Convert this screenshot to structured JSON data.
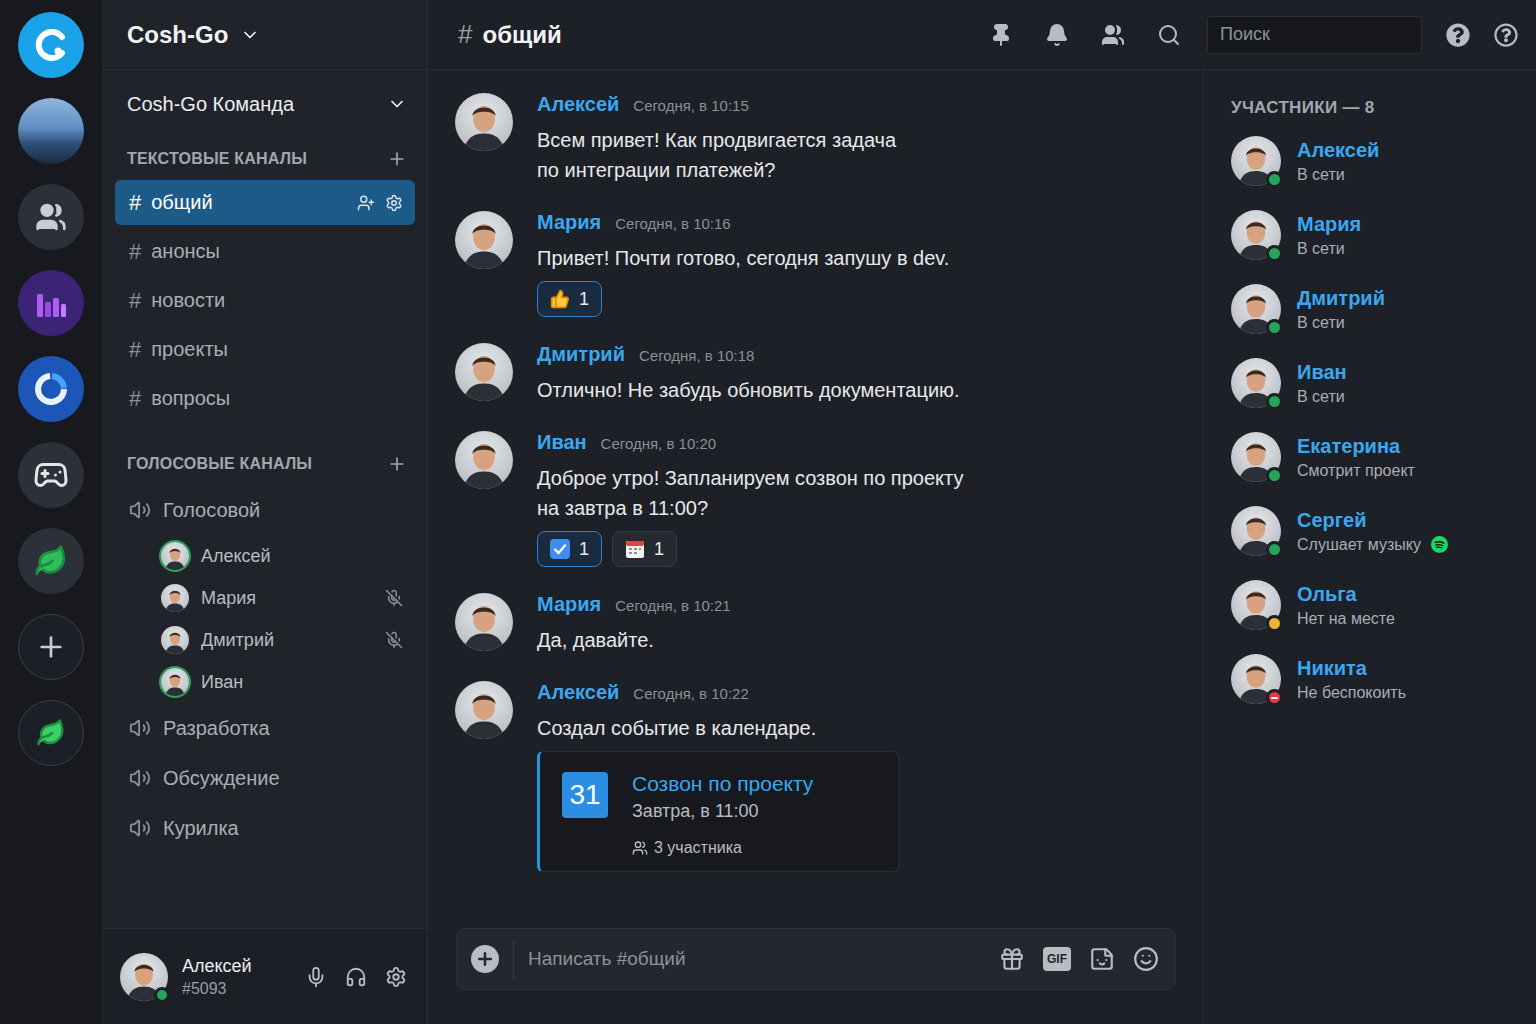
{
  "rail": {
    "items": [
      {
        "kind": "logo",
        "color": "#1aa3e8"
      },
      {
        "kind": "city",
        "color": "#3d6fa8"
      },
      {
        "kind": "people",
        "color": "#2c3038"
      },
      {
        "kind": "chart",
        "color": "#3b2475"
      },
      {
        "kind": "ring",
        "color": "#1b56b8"
      },
      {
        "kind": "gamepad",
        "color": "#2c3038"
      },
      {
        "kind": "leaf",
        "color": "#2c3038"
      },
      {
        "kind": "add",
        "color": "#1c1f25"
      },
      {
        "kind": "leaf-outline",
        "color": "#1c1f25"
      }
    ]
  },
  "sidebar": {
    "server": "Cosh-Go",
    "team": "Cosh-Go Команда",
    "hash": "#",
    "text_section": {
      "title": "ТЕКСТОВЫЕ КАНАЛЫ",
      "channels": [
        {
          "name": "общий",
          "selected": true
        },
        {
          "name": "анонсы",
          "selected": false
        },
        {
          "name": "новости",
          "selected": false
        },
        {
          "name": "проекты",
          "selected": false
        },
        {
          "name": "вопросы",
          "selected": false
        }
      ]
    },
    "voice_section": {
      "title": "ГОЛОСОВЫЕ КАНАЛЫ",
      "channels": [
        {
          "name": "Голосовой",
          "members": [
            {
              "name": "Алексей",
              "speaking": true,
              "muted": false
            },
            {
              "name": "Мария",
              "speaking": false,
              "muted": true
            },
            {
              "name": "Дмитрий",
              "speaking": false,
              "muted": true
            },
            {
              "name": "Иван",
              "speaking": true,
              "muted": false
            }
          ]
        },
        {
          "name": "Разработка",
          "members": []
        },
        {
          "name": "Обсуждение",
          "members": []
        },
        {
          "name": "Курилка",
          "members": []
        }
      ]
    }
  },
  "user_panel": {
    "name": "Алексей",
    "tag": "#5093",
    "status": "online",
    "color": "#23a55a"
  },
  "header": {
    "hash": "#",
    "channel": "общий",
    "search_placeholder": "Поиск"
  },
  "messages": [
    {
      "author": "Алексей",
      "time": "Сегодня, в 10:15",
      "text": "Всем привет! Как продвигается задача\nпо интеграции платежей?",
      "reactions": []
    },
    {
      "author": "Мария",
      "time": "Сегодня, в 10:16",
      "text": "Привет! Почти готово, сегодня запушу в dev.",
      "reactions": [
        {
          "kind": "thumbs-up",
          "count": "1",
          "selected": true
        }
      ]
    },
    {
      "author": "Дмитрий",
      "time": "Сегодня, в 10:18",
      "text": "Отлично! Не забудь обновить документацию.",
      "reactions": []
    },
    {
      "author": "Иван",
      "time": "Сегодня, в 10:20",
      "text": "Доброе утро! Запланируем созвон по проекту\nна завтра в 11:00?",
      "reactions": [
        {
          "kind": "check",
          "count": "1",
          "selected": true
        },
        {
          "kind": "calendar",
          "count": "1",
          "selected": false
        }
      ]
    },
    {
      "author": "Мария",
      "time": "Сегодня, в 10:21",
      "text": "Да, давайте.",
      "reactions": []
    },
    {
      "author": "Алексей",
      "time": "Сегодня, в 10:22",
      "text": "Создал событие в календаре.",
      "reactions": [],
      "embed": {
        "day": "31",
        "title": "Созвон по проекту",
        "when": "Завтра, в 11:00",
        "participants": "3 участника"
      }
    }
  ],
  "composer": {
    "placeholder": "Написать #общий",
    "gif": "GIF"
  },
  "members": {
    "title": "УЧАСТНИКИ — 8",
    "list": [
      {
        "name": "Алексей",
        "activity": "В сети",
        "status": "online",
        "color": "#23a55a",
        "spotify": false
      },
      {
        "name": "Мария",
        "activity": "В сети",
        "status": "online",
        "color": "#23a55a",
        "spotify": false
      },
      {
        "name": "Дмитрий",
        "activity": "В сети",
        "status": "online",
        "color": "#23a55a",
        "spotify": false
      },
      {
        "name": "Иван",
        "activity": "В сети",
        "status": "online",
        "color": "#23a55a",
        "spotify": false
      },
      {
        "name": "Екатерина",
        "activity": "Смотрит проект",
        "status": "online",
        "color": "#23a55a",
        "spotify": false
      },
      {
        "name": "Сергей",
        "activity": "Слушает музыку",
        "status": "online",
        "color": "#23a55a",
        "spotify": true
      },
      {
        "name": "Ольга",
        "activity": "Нет на месте",
        "status": "idle",
        "color": "#f0b232",
        "spotify": false
      },
      {
        "name": "Никита",
        "activity": "Не беспокоить",
        "status": "dnd",
        "color": "#e5393f",
        "spotify": false
      }
    ]
  }
}
